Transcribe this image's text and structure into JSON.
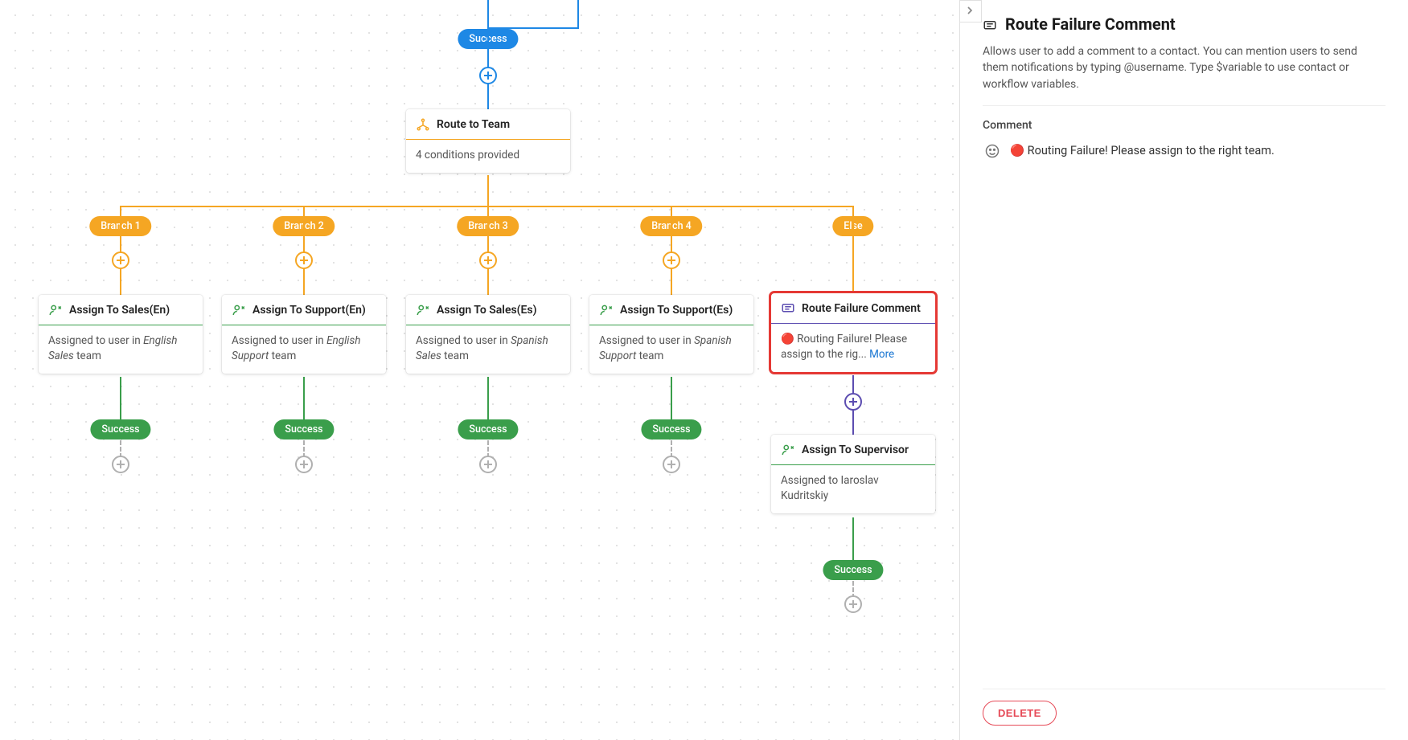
{
  "pills": {
    "top_success": "Success",
    "branch1": "Branch 1",
    "branch2": "Branch 2",
    "branch3": "Branch 3",
    "branch4": "Branch 4",
    "else": "Else",
    "success": "Success"
  },
  "route_card": {
    "title": "Route to Team",
    "subtitle": "4 conditions provided"
  },
  "assign_cards": {
    "sales_en": {
      "title": "Assign To Sales(En)",
      "prefix": "Assigned to user in ",
      "team": "English Sales",
      "suffix": " team"
    },
    "support_en": {
      "title": "Assign To Support(En)",
      "prefix": "Assigned to user in ",
      "team": "English Support",
      "suffix": " team"
    },
    "sales_es": {
      "title": "Assign To Sales(Es)",
      "prefix": "Assigned to user in ",
      "team": "Spanish Sales",
      "suffix": " team"
    },
    "support_es": {
      "title": "Assign To Support(Es)",
      "prefix": "Assigned to user in ",
      "team": "Spanish Support",
      "suffix": " team"
    }
  },
  "failure_card": {
    "title": "Route Failure Comment",
    "body": "🔴 Routing Failure! Please assign to the rig... ",
    "more": "More"
  },
  "supervisor_card": {
    "title": "Assign To Supervisor",
    "body": "Assigned to Iaroslav Kudritskiy"
  },
  "sidebar": {
    "title": "Route Failure Comment",
    "description": "Allows user to add a comment to a contact. You can mention users to send them notifications by typing @username. Type $variable to use contact or workflow variables.",
    "section_label": "Comment",
    "comment_value": "🔴 Routing Failure! Please assign to the right team.",
    "delete_label": "DELETE"
  },
  "geometry": {
    "centerX": 607,
    "branchXs": [
      150,
      378,
      607,
      835,
      1061
    ],
    "topLineBottom": 36,
    "topPillY": 36,
    "plusBlueY": 94,
    "routeCardTop": 136,
    "routeCardBottom": 218,
    "hSplitY": 257,
    "branchPillY": 269,
    "plusOrangeY": 324,
    "assignCardTop": 367,
    "assignCardBottom": 469,
    "successPillY": 522,
    "plusGreyY": 578,
    "failureCardTop": 365,
    "failureCardBottom": 467,
    "plusPurpleY": 500,
    "supervisorCardTop": 541,
    "supervisorCardBottom": 644,
    "else_successPillY": 697,
    "else_plusGreyY": 752
  }
}
